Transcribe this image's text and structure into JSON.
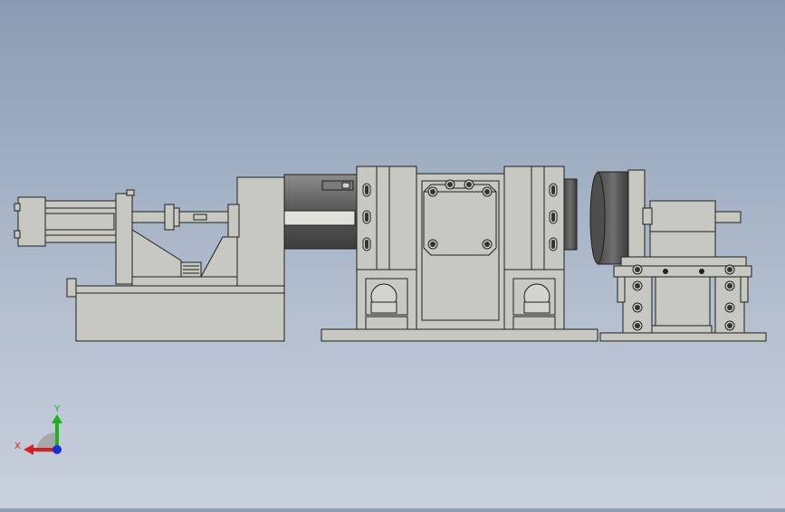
{
  "viewport": {
    "background_top": "#8a9bb3",
    "background_bottom": "#c9d0dc"
  },
  "model": {
    "part_fill": "#c8c8c2",
    "part_stroke": "#1e1e1e",
    "motor_fill": "#5c5c5c",
    "motor_highlight": "#9a9a9a"
  },
  "triad": {
    "x_label": "X",
    "y_label": "Y",
    "x_color": "#d42020",
    "y_color": "#20b020",
    "z_color": "#1a2fd0"
  }
}
